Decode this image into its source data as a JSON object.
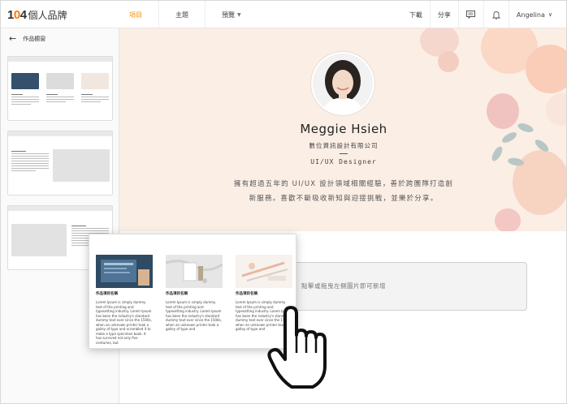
{
  "header": {
    "logo_number": "104",
    "logo_text": "個人品牌",
    "nav": [
      {
        "label": "項目",
        "active": true
      },
      {
        "label": "主題",
        "active": false
      },
      {
        "label": "預覽",
        "active": false
      }
    ],
    "download_label": "下載",
    "share_label": "分享",
    "user_name": "Angelina",
    "accent_color": "#ff9100"
  },
  "sidebar": {
    "title": "作品櫥窗",
    "back_icon": "arrow-left-icon"
  },
  "hero": {
    "name": "Meggie Hsieh",
    "company": "數位資訊設計有限公司",
    "role": "UI/UX Designer",
    "bio_line1": "擁有超過五年的 UI/UX 設計領域相關經驗，善於跨團隊打造創",
    "bio_line2": "新服務。喜歡不斷吸收新知與迎接挑戰，並樂於分享。"
  },
  "drop_zone": {
    "text": "點擊或拖曳左側圖片即可新增"
  },
  "floating_card": {
    "items": [
      {
        "title": "作品項目名稱",
        "body": "Lorem Ipsum is simply dummy text of the printing and typesetting industry. Lorem Ipsum has been the industry's standard dummy text ever since the 1500s, when an unknown printer took a galley of type and scrambled it to make a type specimen book. It has survived not only five centuries, but"
      },
      {
        "title": "作品項目名稱",
        "body": "Lorem Ipsum is simply dummy text of the printing and typesetting industry. Lorem Ipsum has been the industry's standard dummy text ever since the 1500s, when an unknown printer took a galley of type and"
      },
      {
        "title": "作品項目名稱",
        "body": "Lorem Ipsum is simply dummy text of the printing and typesetting industry. Lorem Ipsum has been the industry's standard dummy text ever since the 1500s, when an unknown printer took a galley of type and"
      }
    ]
  }
}
